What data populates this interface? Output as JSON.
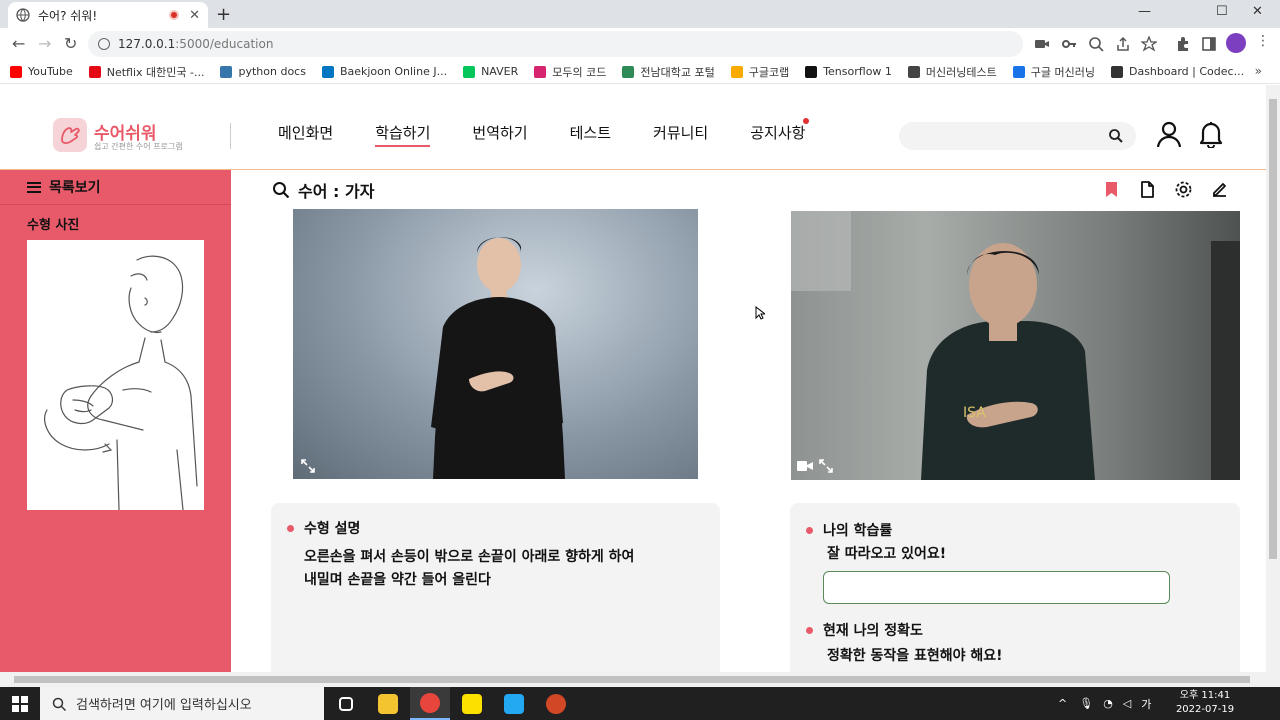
{
  "browser": {
    "tab_title": "수어? 쉬워!",
    "tab_close": "✕",
    "new_tab": "+",
    "win_min": "—",
    "win_max": "☐",
    "win_close": "✕",
    "url_host": "127.0.0.1",
    "url_path": ":5000/education",
    "bookmarks": [
      {
        "label": "YouTube",
        "color": "#ff0000"
      },
      {
        "label": "Netflix 대한민국 -...",
        "color": "#e50914"
      },
      {
        "label": "python docs",
        "color": "#3776ab"
      },
      {
        "label": "Baekjoon Online J...",
        "color": "#0076c0"
      },
      {
        "label": "NAVER",
        "color": "#03c75a"
      },
      {
        "label": "모두의 코드",
        "color": "#d6246e"
      },
      {
        "label": "전남대학교 포털",
        "color": "#2e8b57"
      },
      {
        "label": "구글코랩",
        "color": "#f9ab00"
      },
      {
        "label": "Tensorflow 1",
        "color": "#111111"
      },
      {
        "label": "머신러닝테스트",
        "color": "#444444"
      },
      {
        "label": "구글 머신러닝",
        "color": "#1a73e8"
      },
      {
        "label": "Dashboard | Codec...",
        "color": "#333333"
      }
    ],
    "bookmarks_more": "»"
  },
  "header": {
    "brand": "수어쉬워",
    "tagline": "쉽고 간편한 수어 프로그램",
    "nav": [
      {
        "label": "메인화면",
        "active": false
      },
      {
        "label": "학습하기",
        "active": true
      },
      {
        "label": "번역하기",
        "active": false
      },
      {
        "label": "테스트",
        "active": false
      },
      {
        "label": "커뮤니티",
        "active": false
      },
      {
        "label": "공지사항",
        "active": false
      }
    ],
    "search_placeholder": ""
  },
  "sidebar": {
    "toggle_label": "목록보기",
    "section_label": "수형 사진"
  },
  "content": {
    "title": "수어 : 가자"
  },
  "description": {
    "heading": "수형 설명",
    "line1": "오른손을 펴서 손등이 밖으로 손끝이 아래로 향하게 하여",
    "line2": "내밀며 손끝을 약간 들어 올린다"
  },
  "progress": {
    "heading": "나의 학습률",
    "message": "잘 따라오고 있어요!",
    "value_fraction": 0.0,
    "accuracy_heading": "현재 나의 정확도",
    "accuracy_message": "정확한 동작을 표현해야 해요!"
  },
  "taskbar": {
    "search_placeholder": "검색하려면 여기에 입력하십시오",
    "time": "오후 11:41",
    "date": "2022-07-19"
  },
  "colors": {
    "accent": "#e85a6a",
    "progress_border": "#5a8a5a"
  }
}
